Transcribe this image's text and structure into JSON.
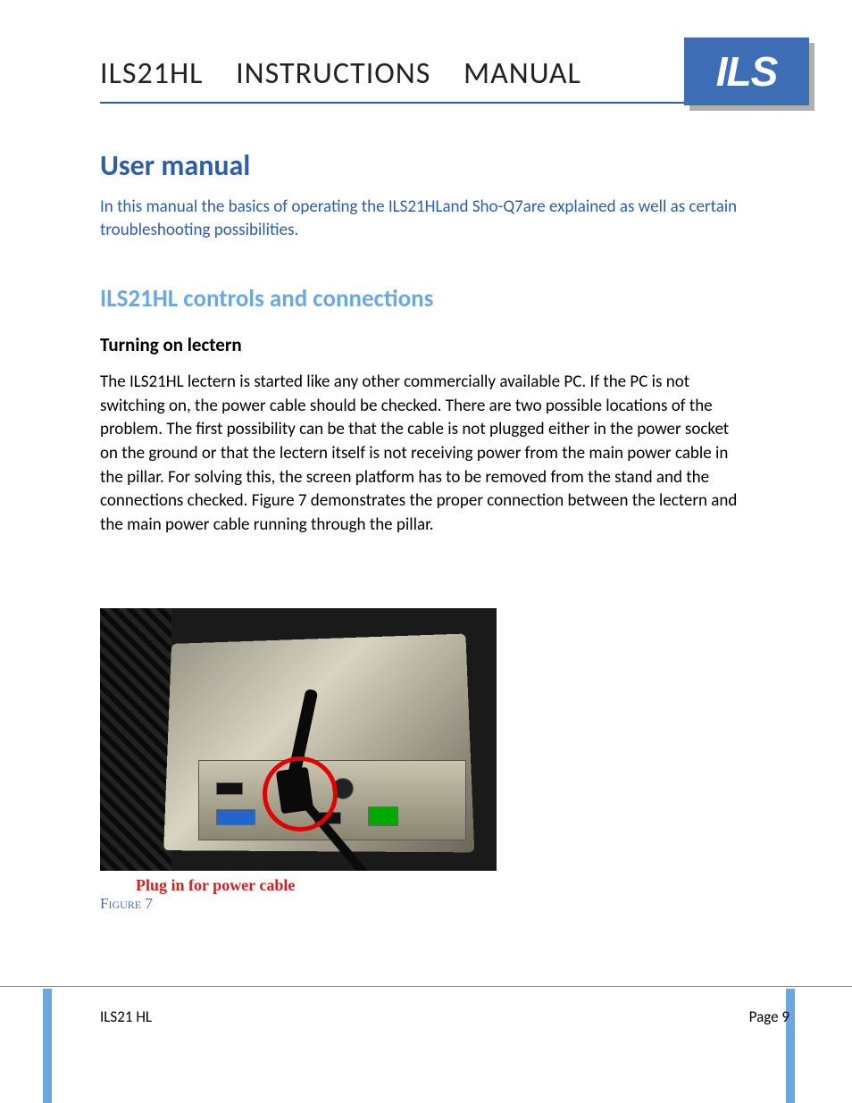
{
  "header": {
    "title": "ILS21HL INSTRUCTIONS MANUAL",
    "logo_text": "ILS"
  },
  "section": {
    "h1": "User manual",
    "intro": "In this manual the basics of operating the ILS21HLand Sho-Q7are explained as well as certain troubleshooting possibilities.",
    "h2": "ILS21HL controls and connections",
    "h3": "Turning on lectern",
    "body": "The ILS21HL lectern is started like any other commercially available PC. If the PC is not switching on, the power cable should be checked. There are two possible locations of the problem. The first possibility can be that the cable is not plugged either in the power socket on the ground or that the lectern itself is not receiving power from the main power cable in the pillar. For solving this, the screen platform has to be removed from the stand and the connections checked. Figure 7 demonstrates the proper connection between the lectern and the main power cable running through the pillar."
  },
  "figure": {
    "caption": "Plug in for power cable",
    "label": "Figure 7"
  },
  "footer": {
    "left": "ILS21 HL",
    "right": "Page 9"
  }
}
